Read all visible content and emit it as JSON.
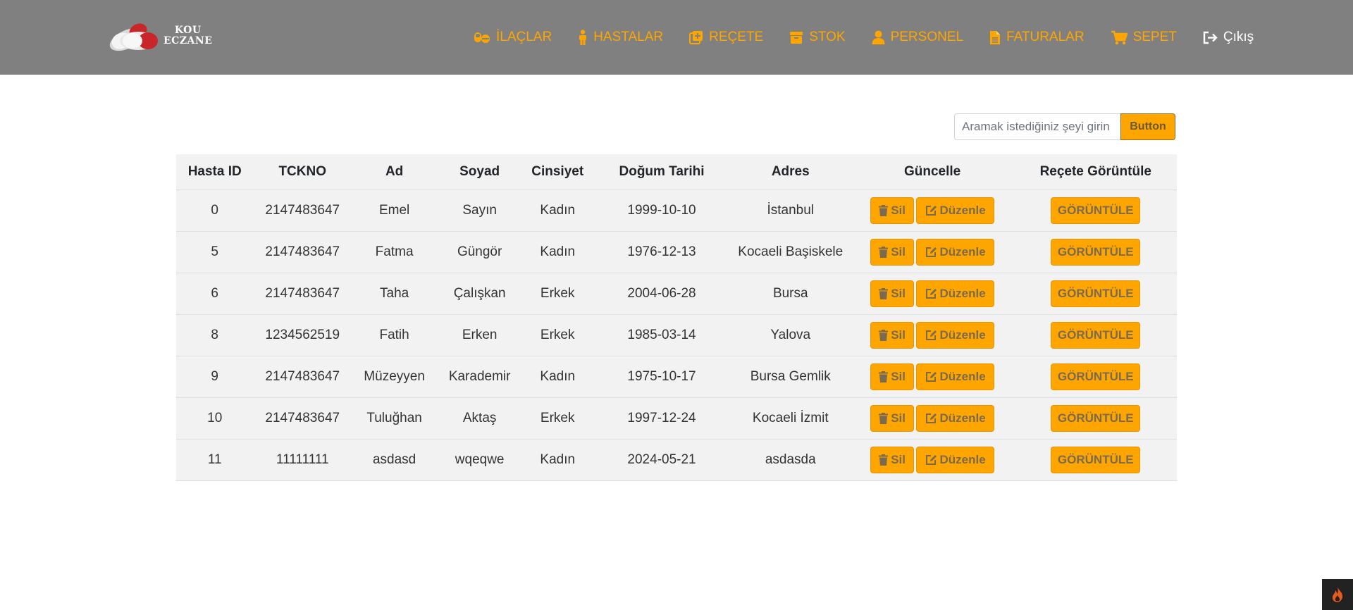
{
  "app": {
    "logo_line1": "KOU",
    "logo_line2": "ECZANE"
  },
  "nav": {
    "items": [
      {
        "label": "İLAÇLAR",
        "icon": "pills-icon"
      },
      {
        "label": "HASTALAR",
        "icon": "person-icon"
      },
      {
        "label": "REÇETE",
        "icon": "prescription-icon"
      },
      {
        "label": "STOK",
        "icon": "box-icon"
      },
      {
        "label": "PERSONEL",
        "icon": "user-icon"
      },
      {
        "label": "FATURALAR",
        "icon": "invoice-icon"
      },
      {
        "label": "SEPET",
        "icon": "cart-icon"
      }
    ],
    "exit_label": "Çıkış"
  },
  "search": {
    "placeholder": "Aramak istediğiniz şeyi girin",
    "button_label": "Button"
  },
  "table": {
    "headers": [
      "Hasta ID",
      "TCKNO",
      "Ad",
      "Soyad",
      "Cinsiyet",
      "Doğum Tarihi",
      "Adres",
      "Güncelle",
      "Reçete Görüntüle"
    ],
    "rows": [
      [
        "0",
        "2147483647",
        "Emel",
        "Sayın",
        "Kadın",
        "1999-10-10",
        "İstanbul"
      ],
      [
        "5",
        "2147483647",
        "Fatma",
        "Güngör",
        "Kadın",
        "1976-12-13",
        "Kocaeli Başiskele"
      ],
      [
        "6",
        "2147483647",
        "Taha",
        "Çalışkan",
        "Erkek",
        "2004-06-28",
        "Bursa"
      ],
      [
        "8",
        "1234562519",
        "Fatih",
        "Erken",
        "Erkek",
        "1985-03-14",
        "Yalova"
      ],
      [
        "9",
        "2147483647",
        "Müzeyyen",
        "Karademir",
        "Kadın",
        "1975-10-17",
        "Bursa Gemlik"
      ],
      [
        "10",
        "2147483647",
        "Tuluğhan",
        "Aktaş",
        "Erkek",
        "1997-12-24",
        "Kocaeli İzmit"
      ],
      [
        "11",
        "11111111",
        "asdasd",
        "wqeqwe",
        "Kadın",
        "2024-05-21",
        "asdasda"
      ]
    ],
    "delete_label": "Sil",
    "edit_label": "Düzenle",
    "view_label": "GÖRÜNTÜLE"
  },
  "colors": {
    "navbar_bg": "#808080",
    "accent": "#ffa500",
    "table_bg": "#f2f2f2"
  }
}
